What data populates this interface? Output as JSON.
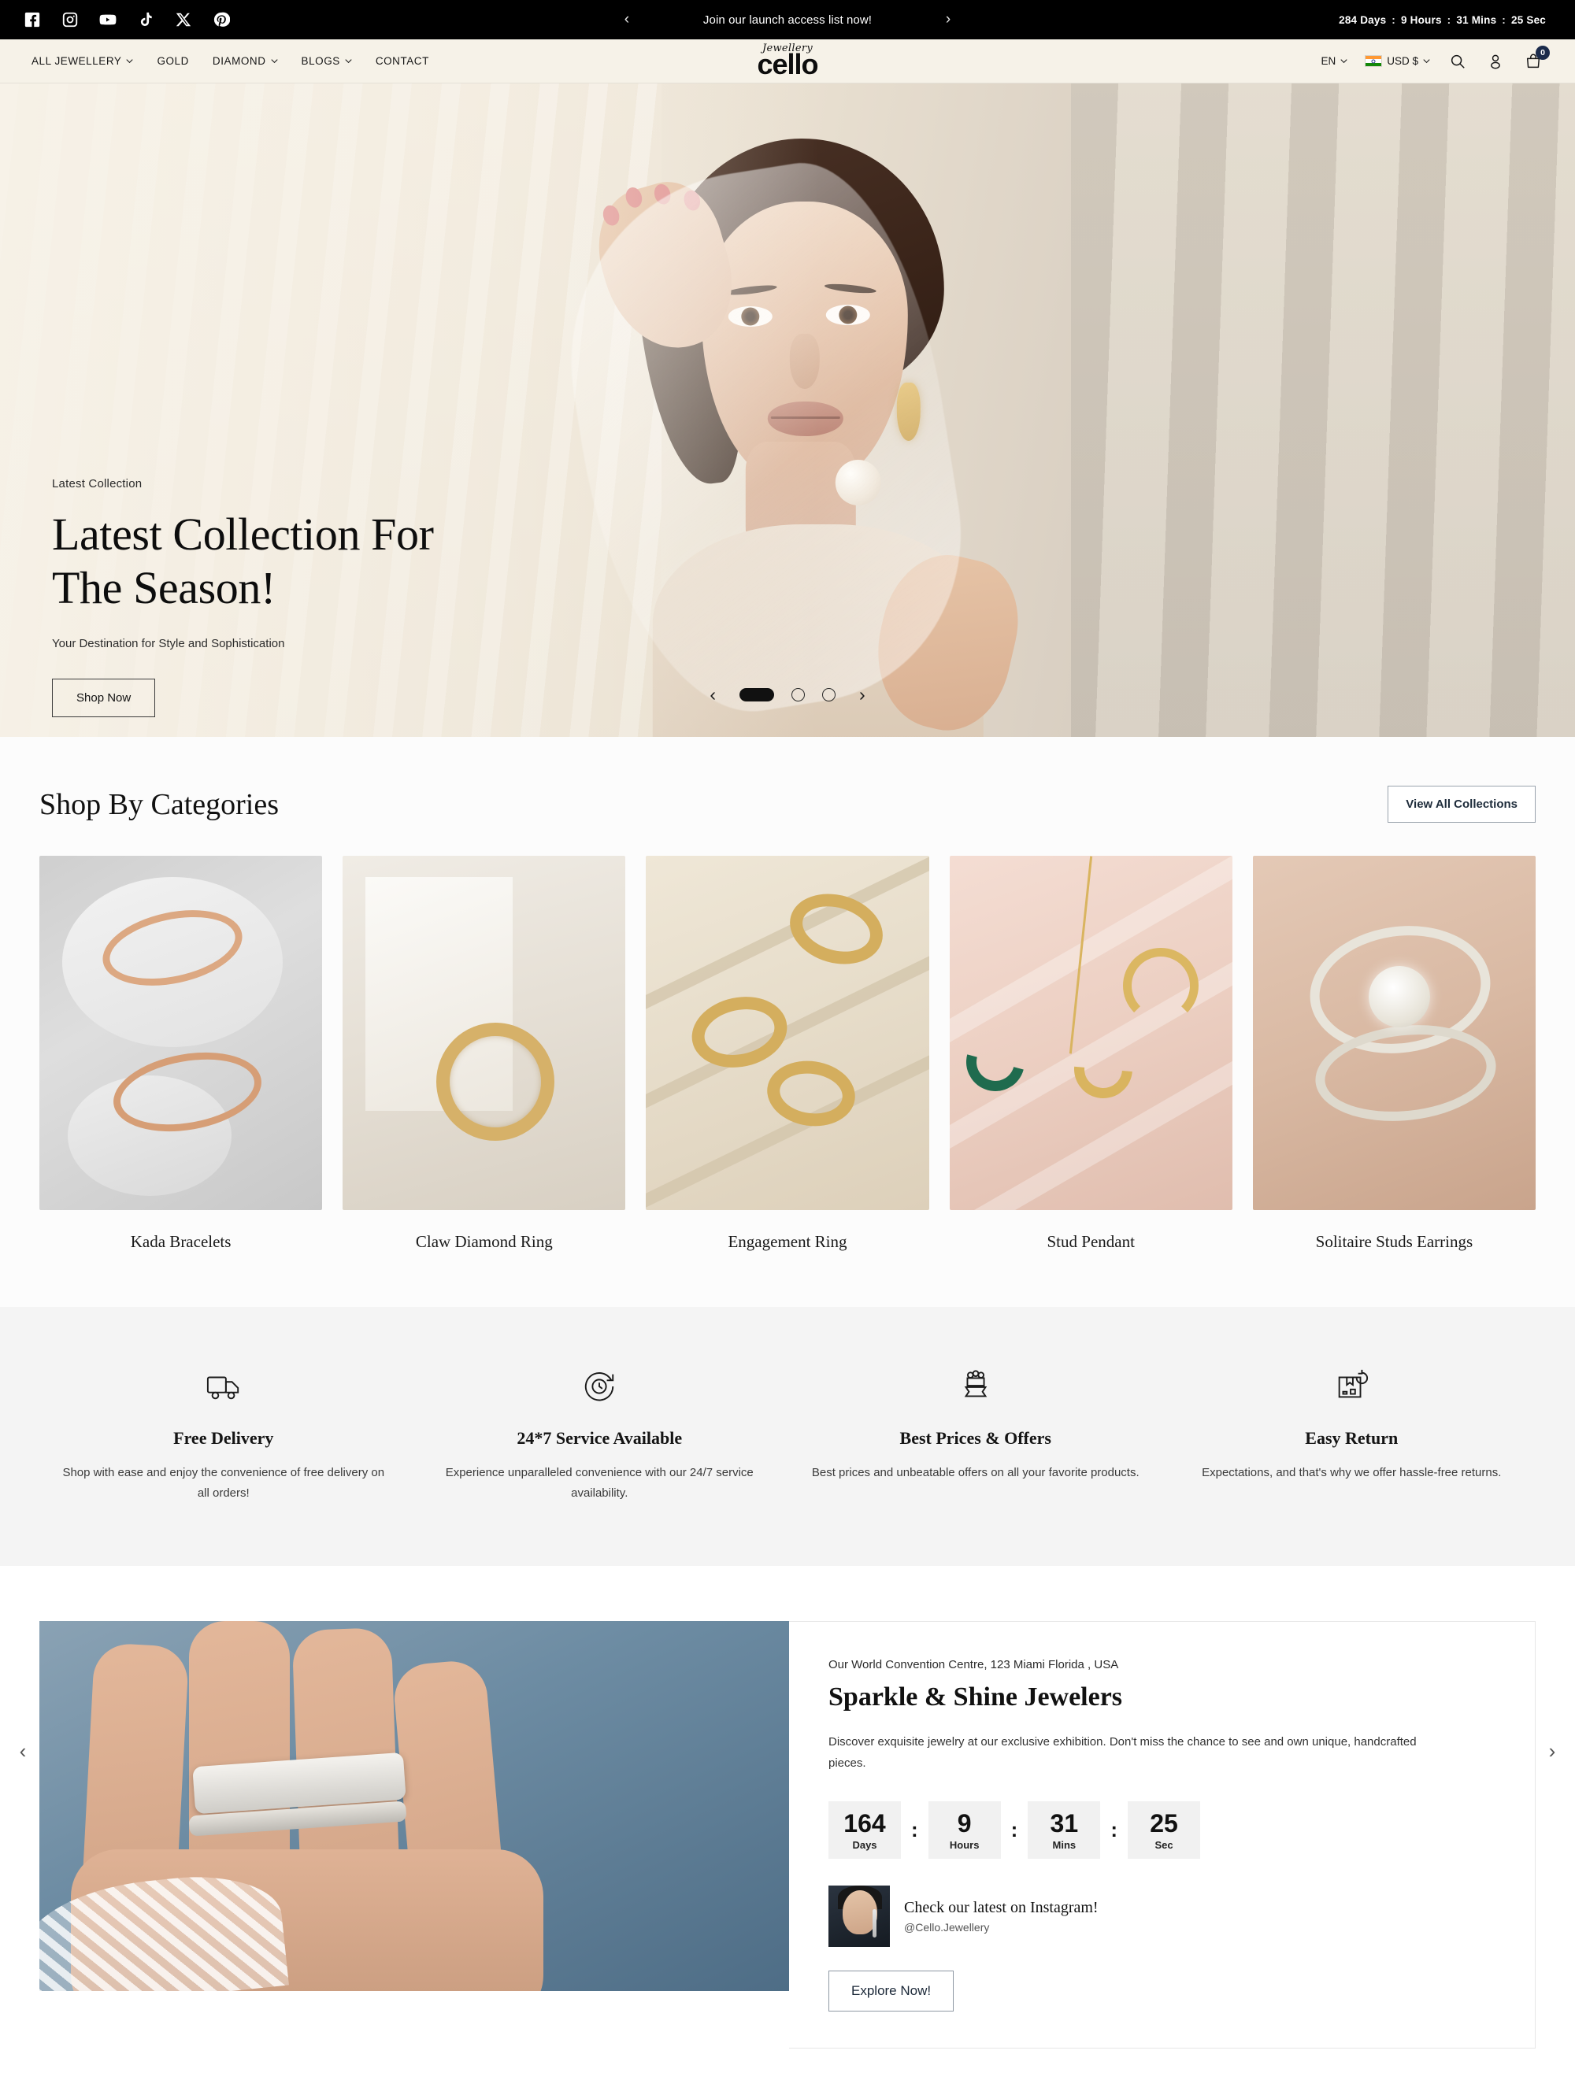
{
  "announcement": {
    "social": [
      {
        "name": "facebook-icon",
        "label": "Facebook"
      },
      {
        "name": "instagram-icon",
        "label": "Instagram"
      },
      {
        "name": "youtube-icon",
        "label": "YouTube"
      },
      {
        "name": "tiktok-icon",
        "label": "TikTok"
      },
      {
        "name": "x-twitter-icon",
        "label": "X"
      },
      {
        "name": "pinterest-icon",
        "label": "Pinterest"
      }
    ],
    "message": "Join our launch access list now!",
    "prev_label": "‹",
    "next_label": "›",
    "timer": {
      "days": "284 Days",
      "hours": "9 Hours",
      "mins": "31 Mins",
      "sec": "25 Sec",
      "separator": ":"
    }
  },
  "header": {
    "nav": [
      {
        "label": "ALL JEWELLERY",
        "has_caret": true
      },
      {
        "label": "GOLD",
        "has_caret": false
      },
      {
        "label": "DIAMOND",
        "has_caret": true
      },
      {
        "label": "BLOGS",
        "has_caret": true
      },
      {
        "label": "CONTACT",
        "has_caret": false
      }
    ],
    "logo": {
      "script": "Jewellery",
      "main": "cello"
    },
    "language": "EN",
    "currency": "USD $",
    "flag": "india-flag",
    "cart_count": "0"
  },
  "hero": {
    "eyebrow": "Latest Collection",
    "title_line1": "Latest Collection For",
    "title_line2": "The Season!",
    "subtitle": "Your Destination for Style and Sophistication",
    "cta": "Shop Now",
    "prev_label": "‹",
    "next_label": "›",
    "slides": 3,
    "active_slide": 1
  },
  "categories": {
    "title": "Shop By Categories",
    "view_all": "View All Collections",
    "prev_label": "‹",
    "next_label": "›",
    "items": [
      {
        "name": "Kada Bracelets",
        "art": "img-bracelets"
      },
      {
        "name": "Claw Diamond Ring",
        "art": "img-claw"
      },
      {
        "name": "Engagement Ring",
        "art": "img-engage"
      },
      {
        "name": "Stud Pendant",
        "art": "img-pendant"
      },
      {
        "name": "Solitaire Studs Earrings",
        "art": "img-solitaire"
      }
    ]
  },
  "features": [
    {
      "icon": "delivery-truck-icon",
      "title": "Free Delivery",
      "desc": "Shop with ease and enjoy the convenience of free delivery on all orders!"
    },
    {
      "icon": "clock-24-7-icon",
      "title": "24*7 Service Available",
      "desc": "Experience unparalleled convenience with our 24/7 service availability."
    },
    {
      "icon": "best-price-badge-icon",
      "title": "Best Prices & Offers",
      "desc": "Best prices and unbeatable offers on all your favorite products."
    },
    {
      "icon": "return-box-icon",
      "title": "Easy Return",
      "desc": "Expectations, and that's why we offer hassle-free returns."
    }
  ],
  "exhibition": {
    "location": "Our World Convention Centre, 123 Miami Florida , USA",
    "title": "Sparkle & Shine Jewelers",
    "description": "Discover exquisite jewelry at our exclusive exhibition. Don't miss the chance to see and own unique, handcrafted pieces.",
    "countdown": {
      "days_num": "164",
      "days_lab": "Days",
      "hours_num": "9",
      "hours_lab": "Hours",
      "mins_num": "31",
      "mins_lab": "Mins",
      "sec_num": "25",
      "sec_lab": "Sec",
      "separator": ":"
    },
    "instagram_title": "Check our latest on Instagram!",
    "instagram_handle": "@Cello.Jewellery",
    "cta": "Explore Now!"
  },
  "colors": {
    "accent_dark": "#1b2b4b",
    "bar_bg": "#000000",
    "header_bg": "#f6f2e8",
    "features_bg": "#f4f4f4"
  }
}
